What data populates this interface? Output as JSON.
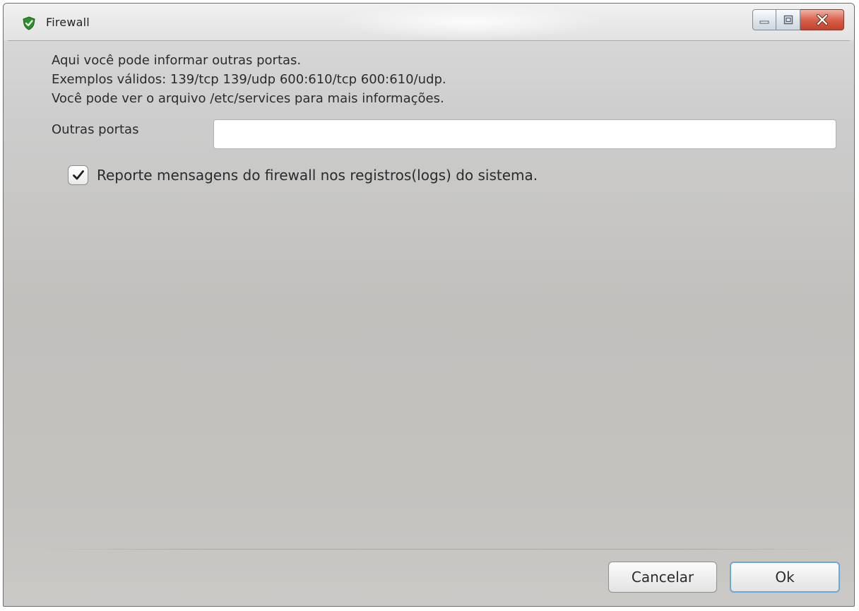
{
  "window": {
    "title": "Firewall",
    "icon": "shield-icon"
  },
  "controls": {
    "minimize_icon": "minimize-icon",
    "maximize_icon": "maximize-icon",
    "close_icon": "close-icon"
  },
  "description": {
    "line1": "Aqui você pode informar outras portas.",
    "line2": "Exemplos válidos: 139/tcp 139/udp 600:610/tcp 600:610/udp.",
    "line3": "Você pode ver o arquivo /etc/services para mais informações."
  },
  "ports": {
    "label": "Outras portas",
    "value": ""
  },
  "log": {
    "checked": true,
    "label": "Reporte mensagens do firewall nos registros(logs) do sistema."
  },
  "buttons": {
    "cancel": "Cancelar",
    "ok": "Ok"
  },
  "colors": {
    "shield": "#3ca33c",
    "close_button": "#d05a43",
    "focus_ring": "#6fa6d6"
  }
}
